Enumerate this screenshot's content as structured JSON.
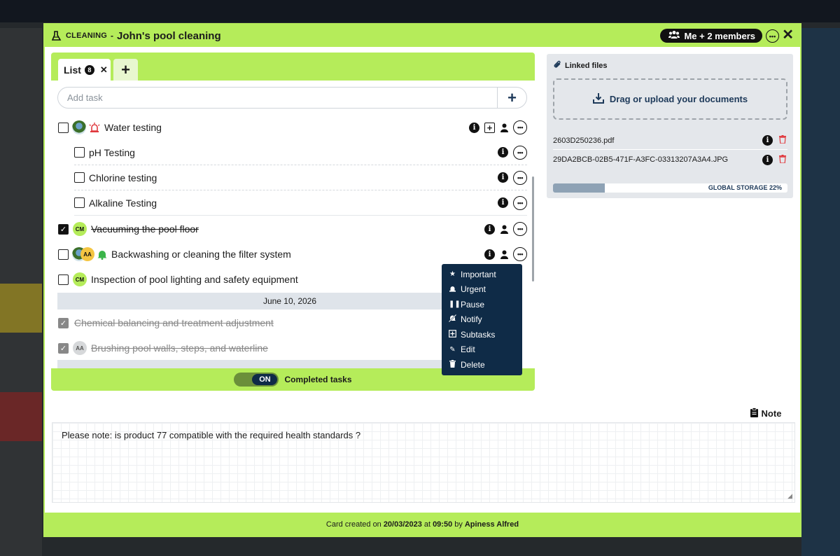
{
  "header": {
    "category": "CLEANING",
    "separator": "-",
    "title": "John's pool cleaning",
    "members_label": "Me + 2 members"
  },
  "tabs": {
    "list_label": "List",
    "list_count": "8"
  },
  "add_task": {
    "placeholder": "Add task"
  },
  "tasks": [
    {
      "label": "Water testing",
      "checked": false
    },
    {
      "label": "pH Testing",
      "checked": false
    },
    {
      "label": "Chlorine testing",
      "checked": false
    },
    {
      "label": "Alkaline Testing",
      "checked": false
    },
    {
      "label": "Vacuuming the pool floor",
      "checked": true,
      "avatar": "CM"
    },
    {
      "label": "Backwashing or cleaning the filter system",
      "checked": false,
      "avatar": "AA"
    },
    {
      "label": "Inspection of pool lighting and safety equipment",
      "checked": false,
      "avatar": "CM"
    }
  ],
  "date_separator": "June 10, 2026",
  "completed_tasks": [
    {
      "label": "Chemical balancing and treatment adjustment",
      "checked": true
    },
    {
      "label": "Brushing pool walls, steps, and waterline",
      "checked": true,
      "avatar": "AA"
    }
  ],
  "toggle": {
    "state": "ON",
    "label": "Completed tasks"
  },
  "context_menu": {
    "items": [
      "Important",
      "Urgent",
      "Pause",
      "Notify",
      "Subtasks",
      "Edit",
      "Delete"
    ]
  },
  "files": {
    "title": "Linked files",
    "dropzone_label": "Drag or upload your documents",
    "items": [
      "2603D250236.pdf",
      "29DA2BCB-02B5-471F-A3FC-03313207A3A4.JPG"
    ],
    "storage_label": "GLOBAL STORAGE 22%",
    "storage_percent": 22
  },
  "note": {
    "tab_label": "Note",
    "content": "Please note: is product 77 compatible with the required health standards ?"
  },
  "footer": {
    "prefix": "Card created on",
    "date": "20/03/2023",
    "at": "at",
    "time": "09:50",
    "by": "by",
    "author": "Apiness Alfred"
  },
  "colors": {
    "accent": "#b5ec5a",
    "navy": "#0f2b47",
    "danger": "#e0393e"
  }
}
